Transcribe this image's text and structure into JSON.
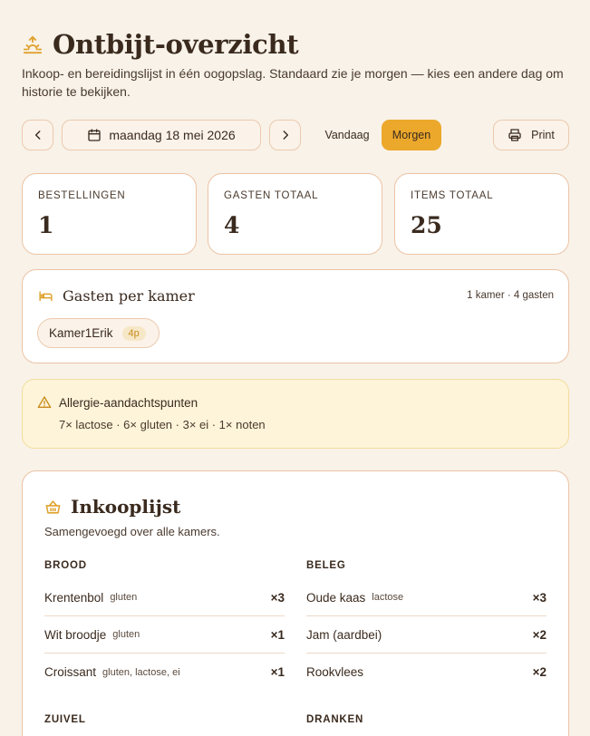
{
  "header": {
    "title": "Ontbijt-overzicht",
    "subtitle": "Inkoop- en bereidingslijst in één oogopslag. Standaard zie je morgen — kies een andere dag om historie te bekijken."
  },
  "toolbar": {
    "date": "maandag 18 mei 2026",
    "today_label": "Vandaag",
    "tomorrow_label": "Morgen",
    "print_label": "Print"
  },
  "stats": [
    {
      "label": "BESTELLINGEN",
      "value": "1"
    },
    {
      "label": "GASTEN TOTAAL",
      "value": "4"
    },
    {
      "label": "ITEMS TOTAAL",
      "value": "25"
    }
  ],
  "guests": {
    "title": "Gasten per kamer",
    "meta": "1 kamer · 4 gasten",
    "rooms": [
      {
        "name": "Kamer1Erik",
        "count": "4p"
      }
    ]
  },
  "allergy": {
    "title": "Allergie-aandachtspunten",
    "text": "7× lactose · 6× gluten · 3× ei · 1× noten"
  },
  "shopping": {
    "title": "Inkooplijst",
    "subtitle": "Samengevoegd over alle kamers.",
    "categories": [
      {
        "title": "BROOD",
        "items": [
          {
            "name": "Krentenbol",
            "tag": "gluten",
            "qty": "×3"
          },
          {
            "name": "Wit broodje",
            "tag": "gluten",
            "qty": "×1"
          },
          {
            "name": "Croissant",
            "tag": "gluten, lactose, ei",
            "qty": "×1"
          }
        ]
      },
      {
        "title": "BELEG",
        "items": [
          {
            "name": "Oude kaas",
            "tag": "lactose",
            "qty": "×3"
          },
          {
            "name": "Jam (aardbei)",
            "tag": "",
            "qty": "×2"
          },
          {
            "name": "Rookvlees",
            "tag": "",
            "qty": "×2"
          }
        ]
      },
      {
        "title": "ZUIVEL",
        "items": []
      },
      {
        "title": "DRANKEN",
        "items": []
      }
    ]
  },
  "colors": {
    "background": "#f8f2e8",
    "accent": "#eca82b",
    "card_border": "#ecc3a6",
    "allergy_bg": "#fdf4d9"
  }
}
